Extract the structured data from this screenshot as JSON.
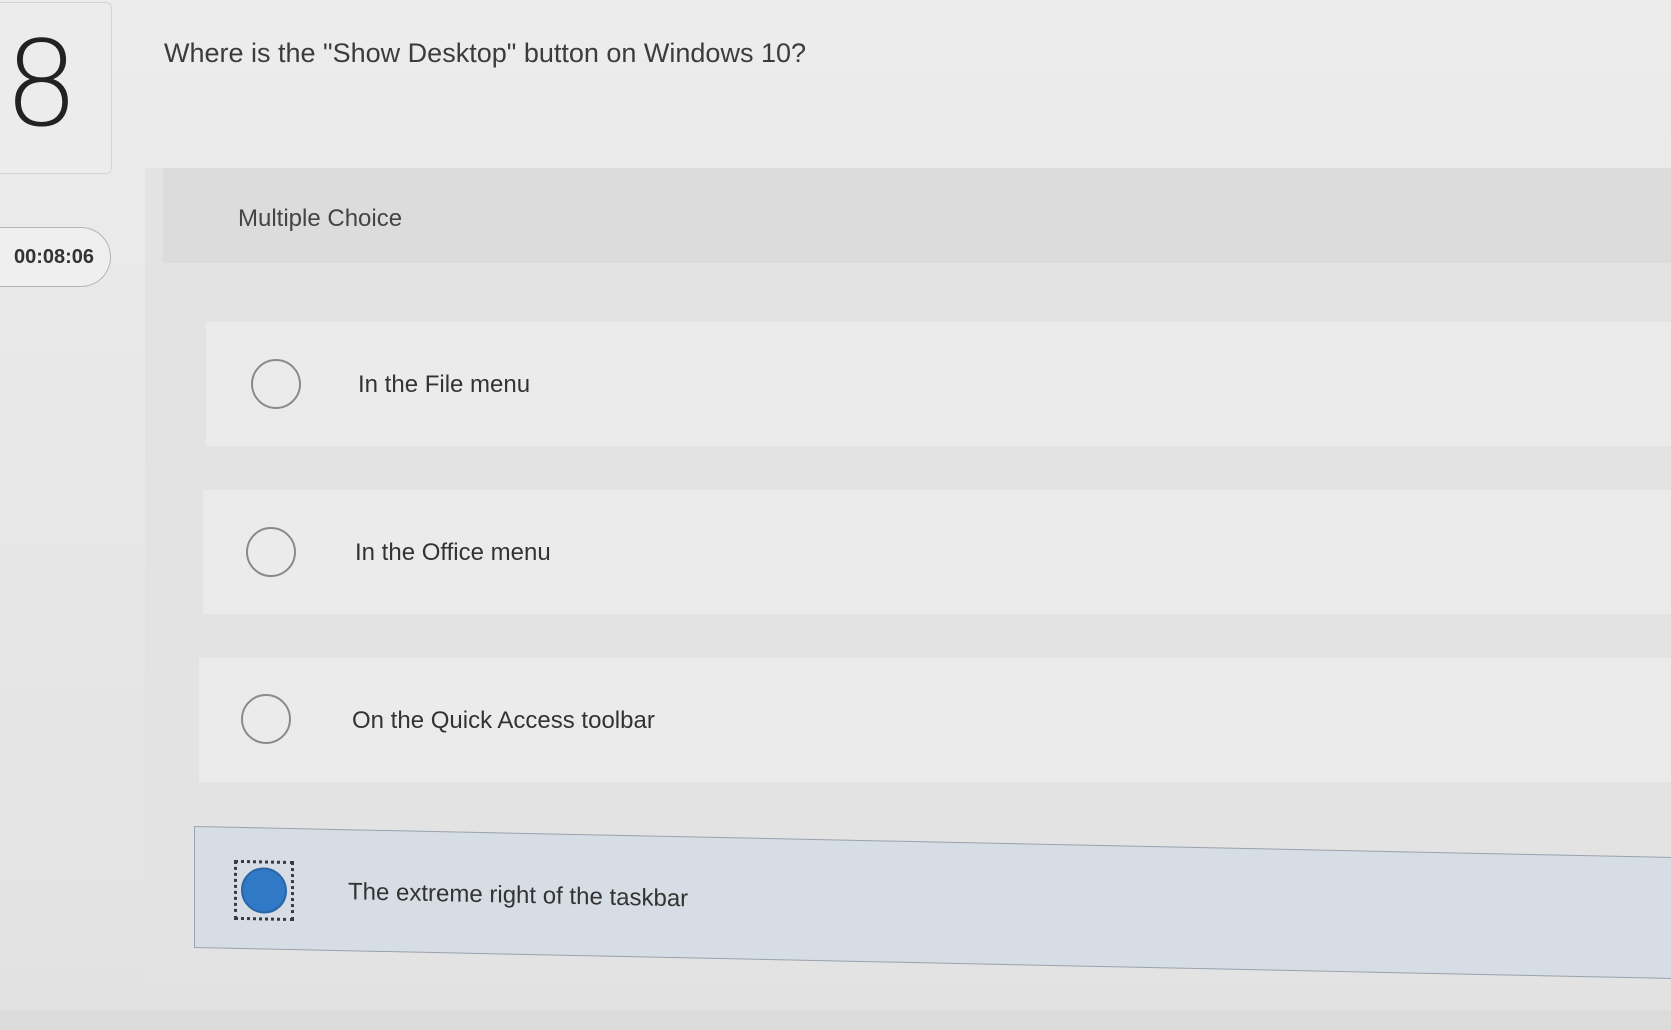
{
  "question": {
    "number": "8",
    "text": "Where is the \"Show Desktop\" button on Windows 10?",
    "type": "Multiple Choice"
  },
  "timer": {
    "value": "00:08:06"
  },
  "choices": [
    {
      "label": "In the File menu",
      "selected": false
    },
    {
      "label": "In the Office menu",
      "selected": false
    },
    {
      "label": "On the Quick Access toolbar",
      "selected": false
    },
    {
      "label": "The extreme right of the taskbar",
      "selected": true
    }
  ],
  "colors": {
    "selected_radio": "#2f79c6",
    "selected_row": "#d7dde4"
  }
}
